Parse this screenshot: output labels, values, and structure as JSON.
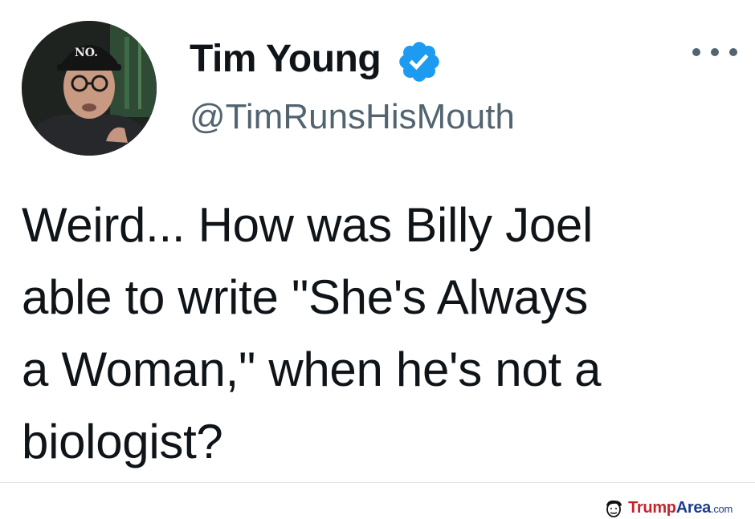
{
  "tweet": {
    "display_name": "Tim Young",
    "handle": "@TimRunsHisMouth",
    "text": "Weird... How was Billy Joel\nable to write \"She's Always\na Woman,\" when he's not a\nbiologist?",
    "verified": true,
    "avatar_icon": "profile-photo",
    "verified_icon": "verified-badge-icon",
    "more_icon": "more-options-icon"
  },
  "watermark": {
    "text": "TrumpArea.com",
    "icon": "trump-face-icon"
  },
  "colors": {
    "verified": "#1d9bf0",
    "handle": "#536471",
    "text": "#0f1419",
    "watermark": "#c8232b"
  }
}
